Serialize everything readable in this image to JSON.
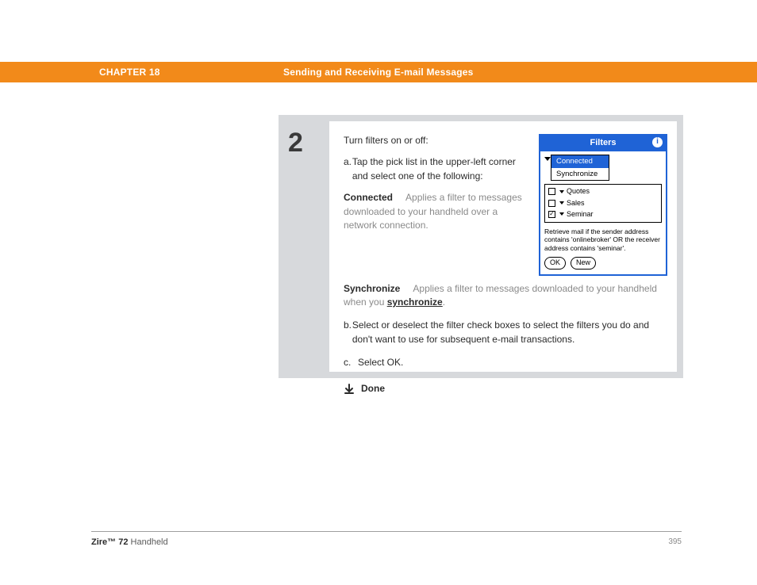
{
  "header": {
    "chapter": "CHAPTER 18",
    "title": "Sending and Receiving E-mail Messages"
  },
  "step": {
    "number": "2",
    "intro": "Turn filters on or off:",
    "a_letter": "a.",
    "a_text": "Tap the pick list in the upper-left corner and select one of the following:",
    "connected_term": "Connected",
    "connected_desc": "Applies a filter to messages downloaded to your handheld over a network connection.",
    "synchronize_term": "Synchronize",
    "synchronize_desc_pre": "Applies a filter to messages downloaded to your handheld when you ",
    "synchronize_link": "synchronize",
    "synchronize_desc_post": ".",
    "b_letter": "b.",
    "b_text": "Select or deselect the filter check boxes to select the filters you do and don't want to use for subsequent e-mail transactions.",
    "c_letter": "c.",
    "c_text": "Select OK.",
    "done": "Done"
  },
  "device": {
    "title": "Filters",
    "pick": {
      "opt1": "Connected",
      "opt2": "Synchronize"
    },
    "rows": [
      {
        "checked": false,
        "label": "Quotes"
      },
      {
        "checked": false,
        "label": "Sales"
      },
      {
        "checked": true,
        "label": "Seminar"
      }
    ],
    "msg": "Retrieve mail if the sender address contains 'onlinebroker' OR the receiver address contains 'seminar'.",
    "btn_ok": "OK",
    "btn_new": "New"
  },
  "footer": {
    "product_bold": "Zire™ 72",
    "product_rest": " Handheld",
    "page": "395"
  }
}
